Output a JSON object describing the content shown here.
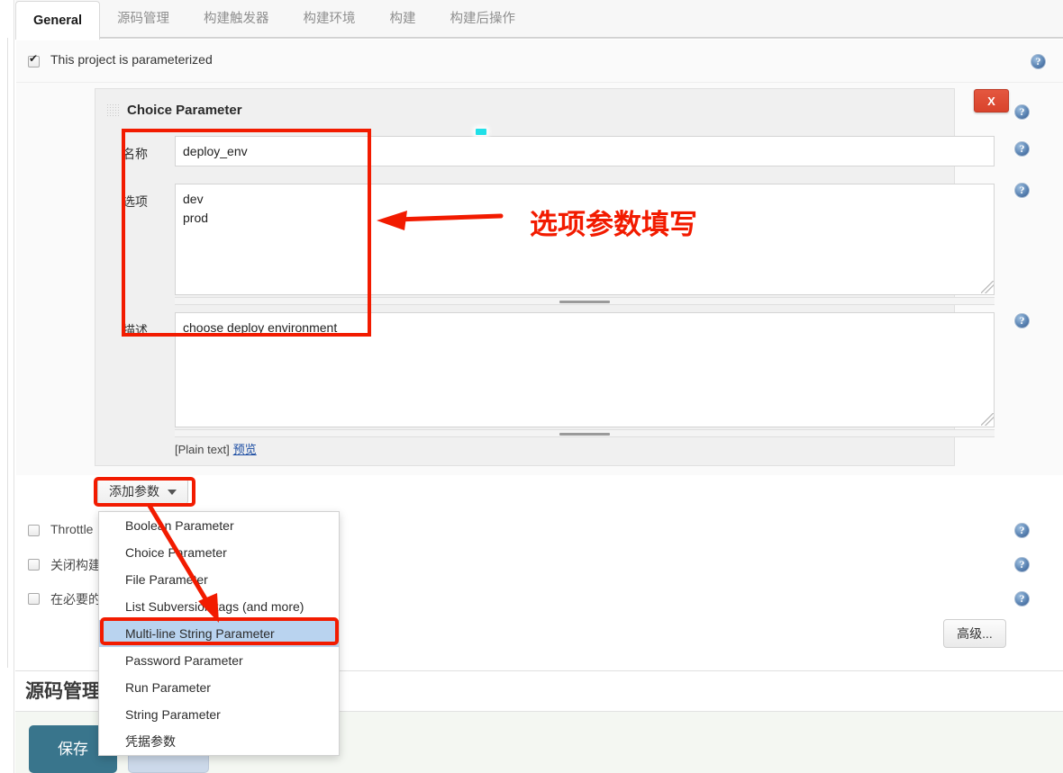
{
  "tabs": [
    {
      "label": "General",
      "active": true
    },
    {
      "label": "源码管理",
      "active": false
    },
    {
      "label": "构建触发器",
      "active": false
    },
    {
      "label": "构建环境",
      "active": false
    },
    {
      "label": "构建",
      "active": false
    },
    {
      "label": "构建后操作",
      "active": false
    }
  ],
  "parameterized": {
    "label": "This project is parameterized",
    "checked": true
  },
  "parameter_panel": {
    "title": "Choice Parameter",
    "delete_label": "X",
    "fields": {
      "name": {
        "label": "名称",
        "value": "deploy_env",
        "placeholder": ""
      },
      "choices": {
        "label": "选项",
        "value": "dev\nprod",
        "placeholder": ""
      },
      "description": {
        "label": "描述",
        "value": "choose deploy environment",
        "placeholder": ""
      }
    },
    "markup_type": "[Plain text]",
    "preview_link": "预览"
  },
  "add_param_button": {
    "label": "添加参数"
  },
  "dropdown": {
    "items": [
      {
        "label": "Boolean Parameter",
        "selected": false
      },
      {
        "label": "Choice Parameter",
        "selected": false
      },
      {
        "label": "File Parameter",
        "selected": false
      },
      {
        "label": "List Subversion tags (and more)",
        "selected": false
      },
      {
        "label": "Multi-line String Parameter",
        "selected": true
      },
      {
        "label": "Password Parameter",
        "selected": false
      },
      {
        "label": "Run Parameter",
        "selected": false
      },
      {
        "label": "String Parameter",
        "selected": false
      },
      {
        "label": "凭据参数",
        "selected": false
      }
    ]
  },
  "options": [
    {
      "label": "Throttle",
      "checked": false
    },
    {
      "label": "关闭构建",
      "checked": false
    },
    {
      "label": "在必要的",
      "checked": false
    }
  ],
  "advanced_button": {
    "label": "高级..."
  },
  "scm_section": {
    "heading": "源码管理"
  },
  "save_bar": {
    "save_label": "保存",
    "apply_label": ""
  },
  "annotations": {
    "callout_text": "选项参数填写",
    "color": "#f21b00"
  },
  "icons": {
    "help": "help-icon",
    "grip": "drag-grip-icon",
    "caret": "chevron-down-icon"
  }
}
